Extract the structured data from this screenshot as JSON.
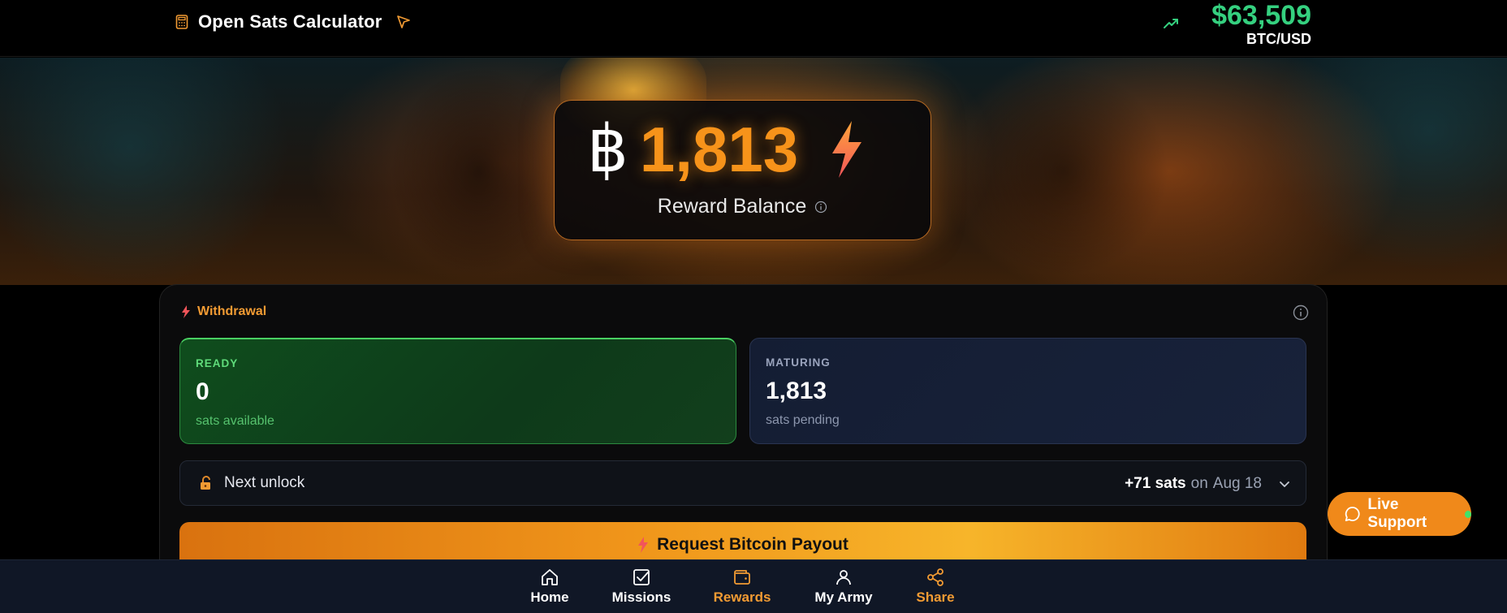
{
  "header": {
    "app_title": "Open Sats Calculator",
    "price": "$63,509",
    "pair": "BTC/USD",
    "icons": [
      "calculator-icon",
      "cursor-icon",
      "trending-up-icon"
    ]
  },
  "balance": {
    "symbol": "฿",
    "value": "1,813",
    "label": "Reward Balance"
  },
  "withdrawal": {
    "title": "Withdrawal",
    "ready": {
      "kicker": "READY",
      "value": "0",
      "sub": "sats available"
    },
    "maturing": {
      "kicker": "MATURING",
      "value": "1,813",
      "sub": "sats pending"
    },
    "next_unlock": {
      "label": "Next unlock",
      "amount": "+71 sats",
      "on": "on",
      "date": "Aug 18"
    },
    "payout_button": "Request Bitcoin Payout"
  },
  "live_support": {
    "label": "Live Support"
  },
  "bottom_nav": {
    "items": [
      {
        "label": "Home",
        "icon": "home-icon"
      },
      {
        "label": "Missions",
        "icon": "check-square-icon"
      },
      {
        "label": "Rewards",
        "icon": "wallet-icon",
        "active": true
      },
      {
        "label": "My Army",
        "icon": "user-icon"
      },
      {
        "label": "Share",
        "icon": "share-icon"
      }
    ]
  },
  "colors": {
    "accent": "#f7931a",
    "price_green": "#35d07f",
    "ready_green": "#0f4d1d",
    "maturing_blue": "#18223a"
  }
}
